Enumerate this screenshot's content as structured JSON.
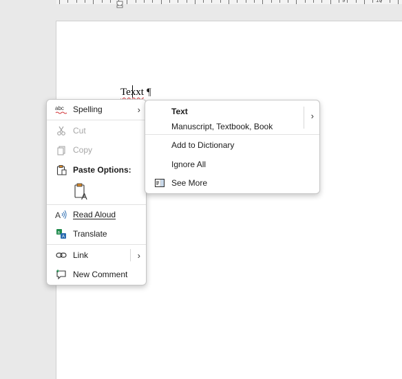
{
  "ruler": {
    "numbers": [
      "9",
      "10"
    ]
  },
  "document": {
    "word": "Texxt",
    "pilcrow": "¶"
  },
  "context_menu": {
    "spelling": {
      "icon": "abc-spelling-icon",
      "label": "Spelling"
    },
    "cut": {
      "label": "Cut",
      "disabled": true
    },
    "copy": {
      "label": "Copy",
      "disabled": true
    },
    "paste_options": {
      "label": "Paste Options:"
    },
    "read_aloud": {
      "label": "Read Aloud"
    },
    "translate": {
      "label": "Translate"
    },
    "link": {
      "label": "Link"
    },
    "new_comment": {
      "label": "New Comment"
    },
    "arrow": "›"
  },
  "spelling_submenu": {
    "suggestion_title": "Text",
    "suggestion_synonyms": "Manuscript, Textbook, Book",
    "add_to_dictionary": "Add to Dictionary",
    "ignore_all": "Ignore All",
    "see_more": "See More",
    "arrow": "›"
  },
  "colors": {
    "accent_blue": "#2b6cb0",
    "spell_red": "#d13438",
    "translate_green": "#1f8a4c",
    "disabled_text": "#a6a6a6"
  }
}
